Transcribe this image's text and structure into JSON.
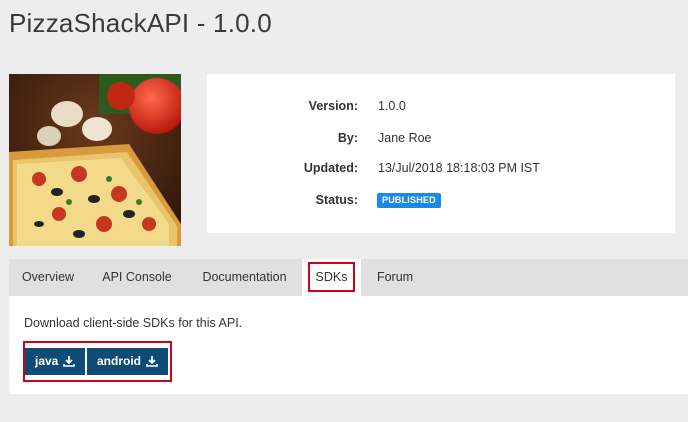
{
  "page": {
    "title": "PizzaShackAPI - 1.0.0"
  },
  "thumbnail": {
    "alt": "pizza-thumbnail"
  },
  "info": {
    "version_label": "Version:",
    "version_value": "1.0.0",
    "by_label": "By:",
    "by_value": "Jane Roe",
    "updated_label": "Updated:",
    "updated_value": "13/Jul/2018 18:18:03 PM IST",
    "status_label": "Status:",
    "status_value": "PUBLISHED",
    "status_color": "#1e88e5"
  },
  "tabs": [
    {
      "label": "Overview"
    },
    {
      "label": "API Console"
    },
    {
      "label": "Documentation"
    },
    {
      "label": "SDKs",
      "active": true
    },
    {
      "label": "Forum"
    }
  ],
  "sdks": {
    "description": "Download client-side SDKs for this API.",
    "buttons": [
      {
        "label": "java",
        "icon": "download-icon"
      },
      {
        "label": "android",
        "icon": "download-icon"
      }
    ],
    "button_color": "#0f4c75",
    "highlight_color": "#d0021b"
  }
}
